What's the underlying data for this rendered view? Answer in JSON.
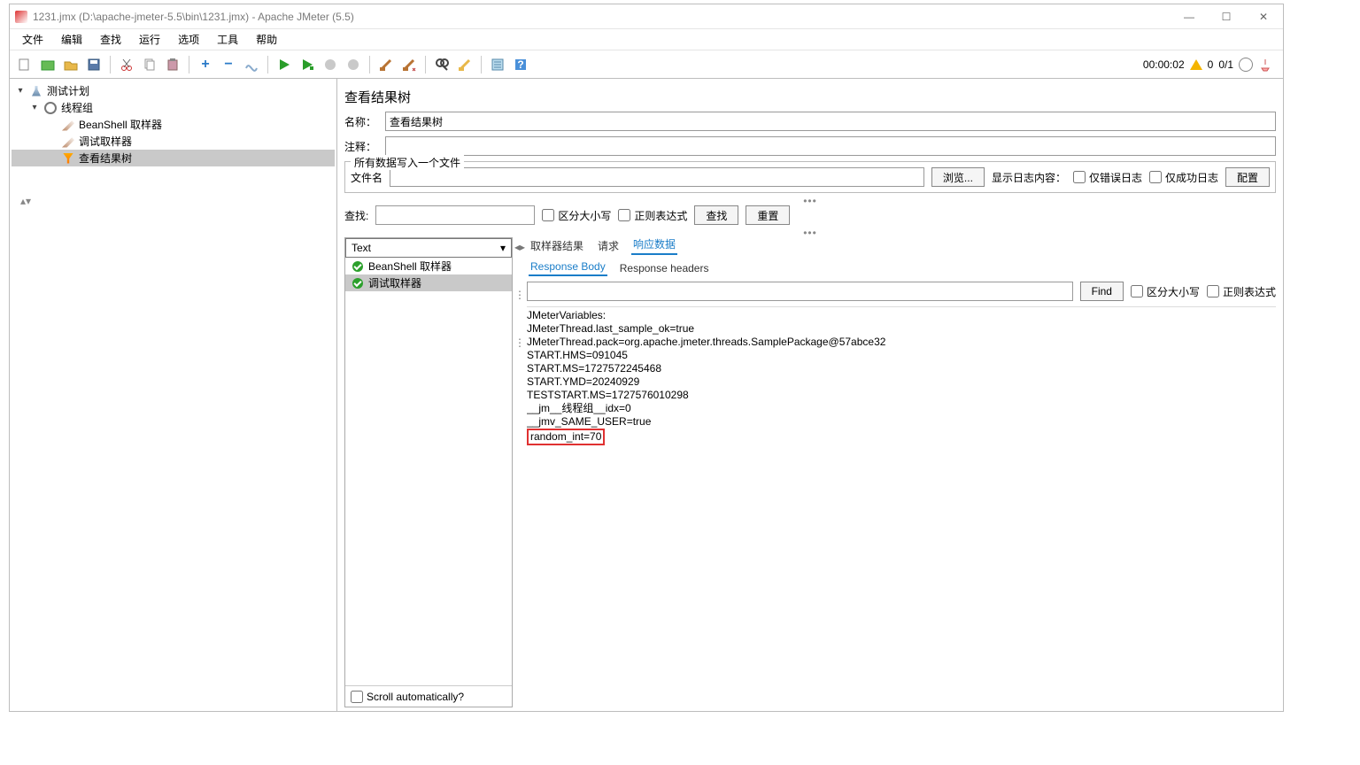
{
  "window": {
    "title": "1231.jmx (D:\\apache-jmeter-5.5\\bin\\1231.jmx) - Apache JMeter (5.5)"
  },
  "menu": {
    "file": "文件",
    "edit": "编辑",
    "search": "查找",
    "run": "运行",
    "options": "选项",
    "tools": "工具",
    "help": "帮助"
  },
  "status": {
    "time": "00:00:02",
    "warn": "0",
    "threads": "0/1"
  },
  "tree": {
    "root": "测试计划",
    "group": "线程组",
    "beanshell": "BeanShell 取样器",
    "debug": "调试取样器",
    "results": "查看结果树"
  },
  "panel": {
    "title": "查看结果树",
    "name_lbl": "名称：",
    "name_val": "查看结果树",
    "comment_lbl": "注释：",
    "fileset": "所有数据写入一个文件",
    "file_lbl": "文件名",
    "browse": "浏览...",
    "showlog": "显示日志内容：",
    "erronly": "仅错误日志",
    "okonly": "仅成功日志",
    "config": "配置",
    "find_lbl": "查找:",
    "casesens": "区分大小写",
    "regex": "正则表达式",
    "find_btn": "查找",
    "reset_btn": "重置",
    "renderer": "Text",
    "samples": {
      "beanshell": "BeanShell 取样器",
      "debug": "调试取样器"
    },
    "tabs": {
      "result": "取样器结果",
      "request": "请求",
      "response": "响应数据"
    },
    "subtabs": {
      "body": "Response Body",
      "headers": "Response headers"
    },
    "find2": "Find",
    "casesens2": "区分大小写",
    "regex2": "正则表达式",
    "scroll": "Scroll automatically?"
  },
  "response": {
    "l1": "JMeterVariables:",
    "l2": "JMeterThread.last_sample_ok=true",
    "l3": "JMeterThread.pack=org.apache.jmeter.threads.SamplePackage@57abce32",
    "l4": "START.HMS=091045",
    "l5": "START.MS=1727572245468",
    "l6": "START.YMD=20240929",
    "l7": "TESTSTART.MS=1727576010298",
    "l8": "__jm__线程组__idx=0",
    "l9": "__jmv_SAME_USER=true",
    "l10": "random_int=70"
  }
}
